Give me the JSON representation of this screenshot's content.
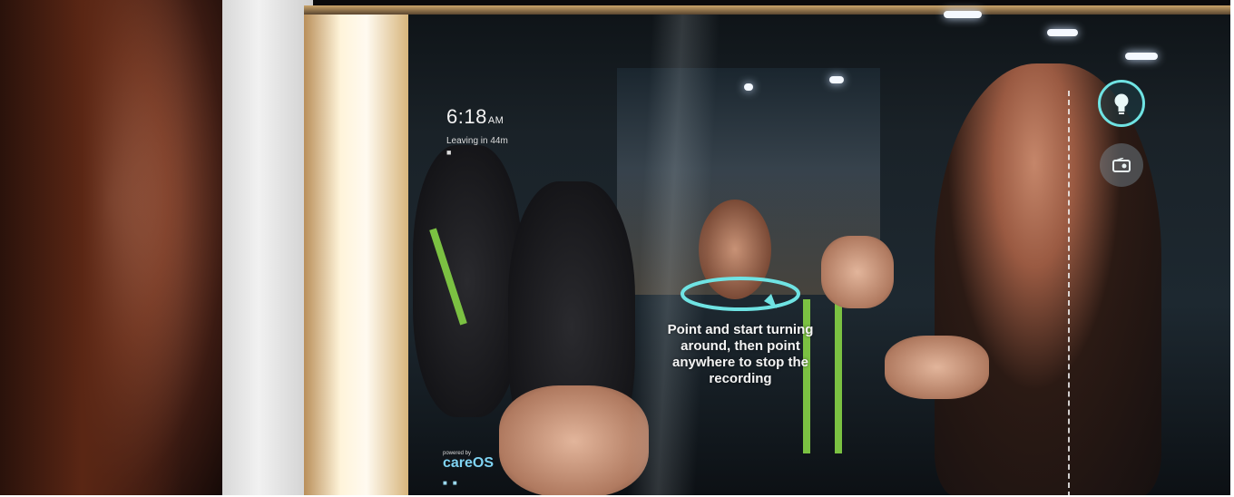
{
  "mirror_ui": {
    "time": "6:18",
    "time_suffix": "AM",
    "leaving_text": "Leaving in 44m",
    "instruction": "Point and start turning around, then point anywhere to stop the recording",
    "brand_prefix": "powered by",
    "brand_name": "careOS",
    "icons": [
      "rotate-icon",
      "lightbulb-icon",
      "radio-icon",
      "car-icon"
    ]
  },
  "colors": {
    "accent_ring": "#6fe3e3",
    "brand_blue": "#7fd3f2",
    "text": "#f4f4f4"
  }
}
